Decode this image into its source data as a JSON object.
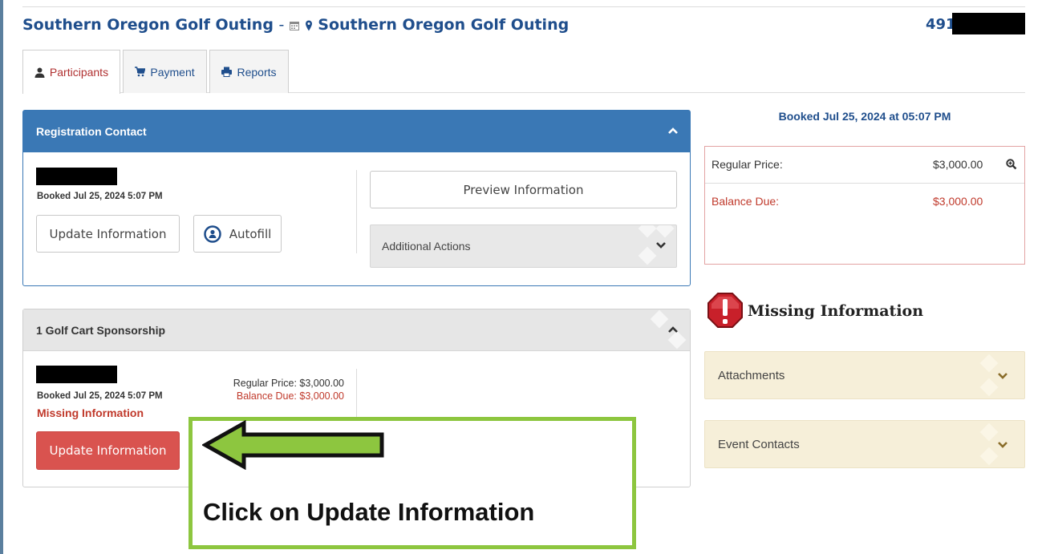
{
  "header": {
    "event_title": "Southern Oregon Golf Outing",
    "title_separator": "-",
    "location_title": "Southern Oregon Golf Outing",
    "reference_prefix": "491"
  },
  "tabs": [
    {
      "label": "Participants",
      "icon": "user-icon",
      "active": true
    },
    {
      "label": "Payment",
      "icon": "cart-icon",
      "active": false
    },
    {
      "label": "Reports",
      "icon": "print-icon",
      "active": false
    }
  ],
  "registration_contact": {
    "title": "Registration Contact",
    "booked_text": "Booked Jul 25, 2024 5:07 PM",
    "update_button": "Update Information",
    "autofill_button": "Autofill",
    "preview_button": "Preview Information",
    "additional_actions": "Additional Actions"
  },
  "sponsorship": {
    "title": "1 Golf Cart Sponsorship",
    "booked_text": "Booked Jul 25, 2024 5:07 PM",
    "missing_text": "Missing Information",
    "regular_price_text": "Regular Price: $3,000.00",
    "balance_due_text": "Balance Due: $3,000.00",
    "update_button": "Update Information"
  },
  "summary": {
    "booked_heading": "Booked Jul 25, 2024 at 05:07 PM",
    "regular_price_label": "Regular Price:",
    "regular_price_value": "$3,000.00",
    "balance_due_label": "Balance Due:",
    "balance_due_value": "$3,000.00"
  },
  "missing_information": {
    "title": "Missing Information"
  },
  "accordions": [
    {
      "label": "Attachments"
    },
    {
      "label": "Event Contacts"
    }
  ],
  "callout": {
    "text": "Click on Update Information"
  },
  "colors": {
    "brand_blue": "#1f4e8c",
    "panel_blue": "#3a78b5",
    "danger_red": "#d9534f",
    "callout_green": "#8dc63f"
  }
}
